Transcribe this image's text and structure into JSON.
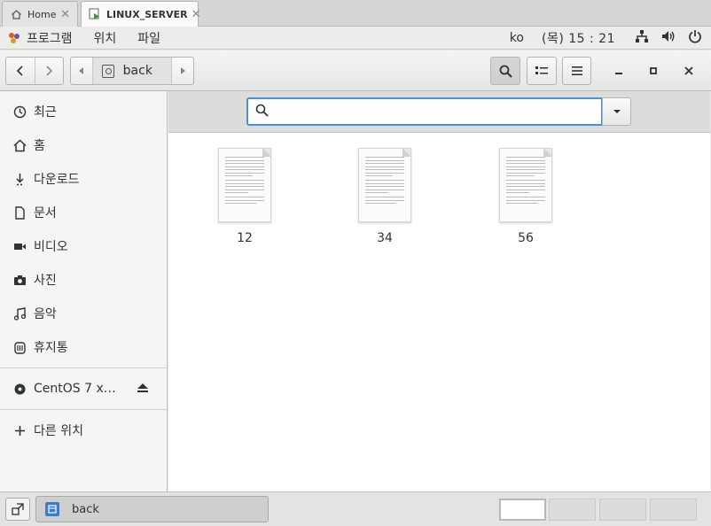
{
  "tabs": [
    {
      "label": "Home",
      "icon": "home-icon",
      "active": false
    },
    {
      "label": "LINUX_SERVER",
      "icon": "vm-icon",
      "active": true
    }
  ],
  "top_panel": {
    "menu": [
      "프로그램",
      "위치",
      "파일"
    ],
    "input_method": "ko",
    "clock": "(목) 15 : 21"
  },
  "header": {
    "path_current": "back"
  },
  "sidebar": {
    "items": [
      {
        "label": "최근",
        "icon": "recent-icon"
      },
      {
        "label": "홈",
        "icon": "home-icon"
      },
      {
        "label": "다운로드",
        "icon": "download-icon"
      },
      {
        "label": "문서",
        "icon": "document-icon"
      },
      {
        "label": "비디오",
        "icon": "video-icon"
      },
      {
        "label": "사진",
        "icon": "camera-icon"
      },
      {
        "label": "음악",
        "icon": "music-icon"
      },
      {
        "label": "휴지통",
        "icon": "trash-icon"
      }
    ],
    "devices": [
      {
        "label": "CentOS 7 x…",
        "icon": "disc-icon"
      }
    ],
    "other": {
      "label": "다른 위치",
      "icon": "plus-icon"
    }
  },
  "search": {
    "value": "",
    "placeholder": ""
  },
  "files": [
    {
      "name": "12"
    },
    {
      "name": "34"
    },
    {
      "name": "56"
    }
  ],
  "taskbar": {
    "window_label": "back"
  },
  "colors": {
    "accent": "#4a90d9",
    "sidebar_bg": "#f5f5f4",
    "header_bg": "#e6e6e5"
  }
}
